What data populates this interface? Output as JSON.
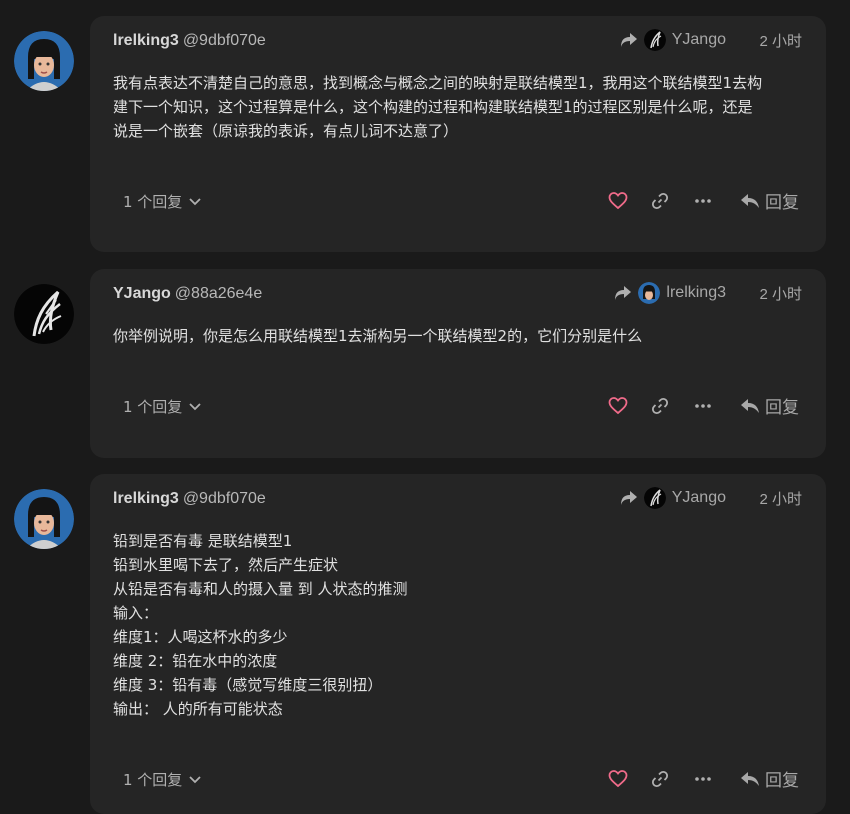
{
  "icons": {
    "share": "share-arrow-icon",
    "heart": "heart-icon",
    "link": "link-icon",
    "more": "more-dots-icon",
    "reply": "reply-icon",
    "chevron": "chevron-down-icon"
  },
  "colors": {
    "heart": "#f06b8a",
    "card": "#252525",
    "background": "#1a1a1a"
  },
  "posts": [
    {
      "username": "lrelking3",
      "handle": "@9dbf070e",
      "reply_to": "YJango",
      "time": "2 小时",
      "content": [
        "我有点表达不清楚自己的意思，找到概念与概念之间的映射是联结模型1，我用这个联结模型1去构",
        "建下一个知识，这个过程算是什么，这个构建的过程和构建联结模型1的过程区别是什么呢，还是",
        "说是一个嵌套（原谅我的表诉，有点儿词不达意了）"
      ],
      "replies_label": "1 个回复",
      "reply_label": "回复"
    },
    {
      "username": "YJango",
      "handle": "@88a26e4e",
      "reply_to": "lrelking3",
      "time": "2 小时",
      "content": [
        "你举例说明，你是怎么用联结模型1去渐构另一个联结模型2的，它们分别是什么"
      ],
      "replies_label": "1 个回复",
      "reply_label": "回复"
    },
    {
      "username": "lrelking3",
      "handle": "@9dbf070e",
      "reply_to": "YJango",
      "time": "2 小时",
      "content": [
        "铅到是否有毒 是联结模型1",
        "铅到水里喝下去了，然后产生症状",
        "从铅是否有毒和人的摄入量 到 人状态的推测",
        "输入：",
        "维度1：人喝这杯水的多少",
        "维度 2：铅在水中的浓度",
        "维度 3：铅有毒（感觉写维度三很别扭）",
        "输出： 人的所有可能状态"
      ],
      "replies_label": "1 个回复",
      "reply_label": "回复"
    }
  ]
}
